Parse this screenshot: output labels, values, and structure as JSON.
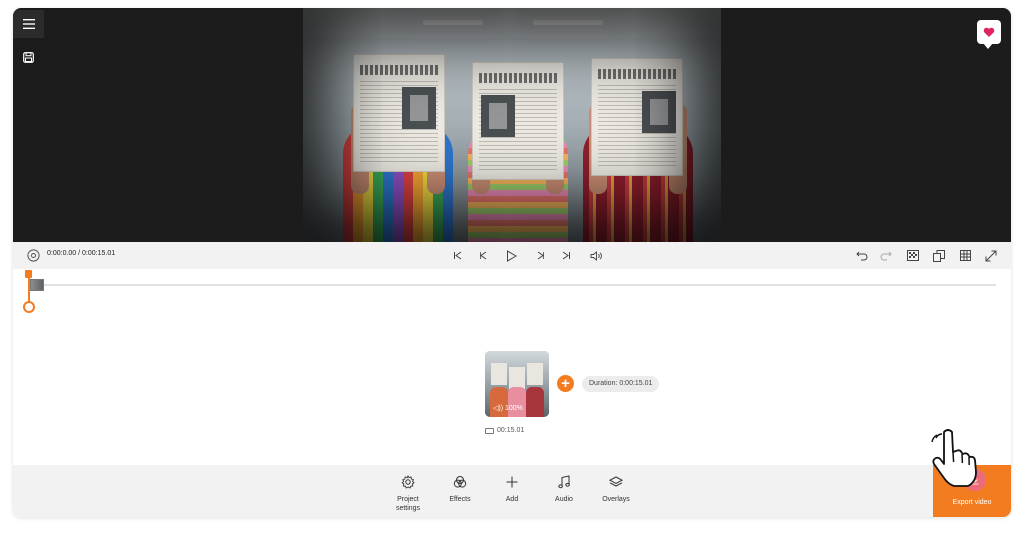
{
  "player": {
    "timecode": "0:00:0.00 / 0:00:15.01"
  },
  "timeline": {
    "clip_volume": "◁)) 100%",
    "clip_duration": "00:15.01",
    "duration_pill": "Duration: 0:00:15.01"
  },
  "toolbar": {
    "items": [
      {
        "label": "Project\nsettings",
        "icon": "gear-icon"
      },
      {
        "label": "Effects",
        "icon": "effects-icon"
      },
      {
        "label": "Add",
        "icon": "plus-icon"
      },
      {
        "label": "Audio",
        "icon": "music-note-icon"
      },
      {
        "label": "Overlays",
        "icon": "layers-icon"
      }
    ],
    "export_label": "Export video"
  },
  "colors": {
    "accent": "#f47c20",
    "preview_bg": "#1c1c1c",
    "panel_bg": "#f2f2f2"
  }
}
